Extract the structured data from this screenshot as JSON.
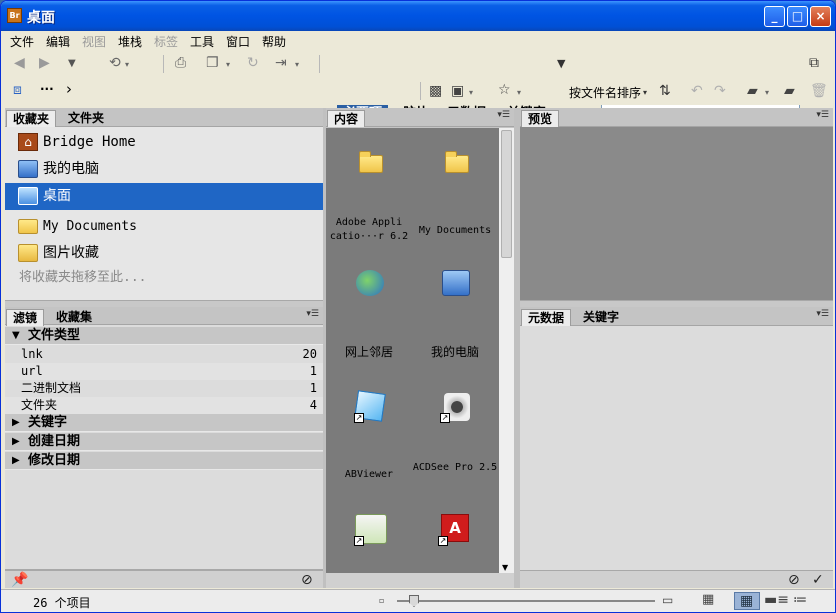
{
  "window": {
    "title": "桌面",
    "app_icon_text": "Br",
    "controls": [
      "_",
      "□",
      "×"
    ]
  },
  "menu": [
    {
      "label": "文件",
      "enabled": true
    },
    {
      "label": "编辑",
      "enabled": true
    },
    {
      "label": "视图",
      "enabled": false
    },
    {
      "label": "堆栈",
      "enabled": true
    },
    {
      "label": "标签",
      "enabled": false
    },
    {
      "label": "工具",
      "enabled": true
    },
    {
      "label": "窗口",
      "enabled": true
    },
    {
      "label": "帮助",
      "enabled": true
    }
  ],
  "workspaces": {
    "essentials": "必要项",
    "filmstrip": "胶片",
    "metadata": "元数据",
    "keywords": "关键字"
  },
  "search": {
    "placeholder": ""
  },
  "path_bar": {
    "ellipsis": "···",
    "chevron": "›"
  },
  "sort_label": "按文件名排序",
  "favorites_panel": {
    "tabs": [
      "收藏夹",
      "文件夹"
    ],
    "items": [
      {
        "label": "Bridge Home",
        "icon": "bridge-home-icon"
      },
      {
        "label": "我的电脑",
        "icon": "computer-icon"
      },
      {
        "label": "桌面",
        "icon": "desktop-icon",
        "selected": true
      },
      {
        "label": "My Documents",
        "icon": "folder-icon"
      },
      {
        "label": "图片收藏",
        "icon": "pictures-folder-icon"
      }
    ],
    "drop_hint": "将收藏夹拖移至此..."
  },
  "filter_panel": {
    "tabs": [
      "滤镜",
      "收藏集"
    ],
    "sections": [
      {
        "label": "文件类型",
        "expanded": true,
        "rows": [
          {
            "name": "lnk",
            "count": "20"
          },
          {
            "name": "url",
            "count": "1"
          },
          {
            "name": "二进制文档",
            "count": "1"
          },
          {
            "name": "文件夹",
            "count": "4"
          }
        ]
      },
      {
        "label": "关键字",
        "expanded": false
      },
      {
        "label": "创建日期",
        "expanded": false
      },
      {
        "label": "修改日期",
        "expanded": false
      }
    ]
  },
  "content_panel": {
    "tab": "内容",
    "items": [
      {
        "label": "Adobe Appli catio···r 6.2",
        "icon": "folder-icon"
      },
      {
        "label": "My Documents",
        "icon": "folder-icon"
      },
      {
        "label": "网上邻居",
        "icon": "network-icon"
      },
      {
        "label": "我的电脑",
        "icon": "computer-icon"
      },
      {
        "label": "ABViewer",
        "icon": "abviewer-icon"
      },
      {
        "label": "ACDSee Pro 2.5",
        "icon": "acdsee-icon"
      },
      {
        "label": "",
        "icon": "app-shortcut-icon"
      },
      {
        "label": "",
        "icon": "adobe-reader-icon"
      }
    ]
  },
  "preview_panel": {
    "tab": "预览"
  },
  "metadata_panel": {
    "tabs": [
      "元数据",
      "关键字"
    ]
  },
  "status": {
    "item_count": "26 个项目"
  },
  "colors": {
    "title_bar": "#0054e3",
    "selection": "#1f66c5",
    "active_workspace": "#2a5fa3",
    "panel_bg": "#d8d8d8",
    "content_bg": "#7b7b7b"
  }
}
